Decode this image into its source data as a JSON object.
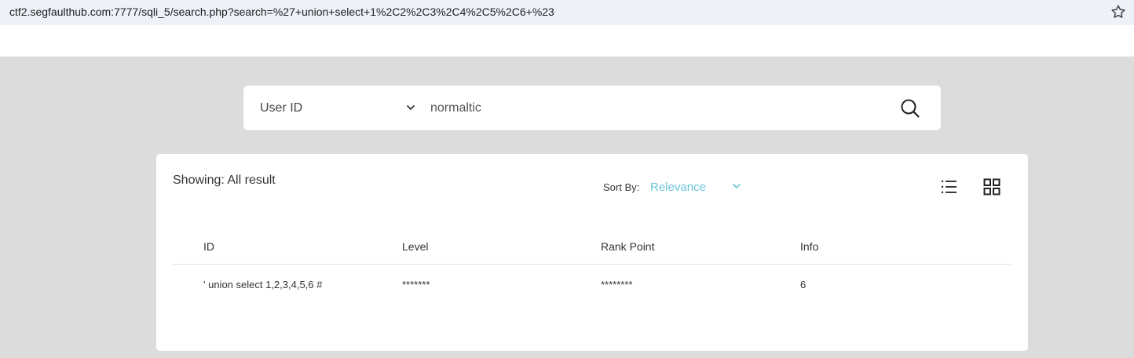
{
  "browser": {
    "url": "ctf2.segfaulthub.com:7777/sqli_5/search.php?search=%27+union+select+1%2C2%2C3%2C4%2C5%2C6+%23"
  },
  "search": {
    "field_selected": "User ID",
    "query": "normaltic"
  },
  "results": {
    "showing_text": "Showing: All result",
    "sort_label": "Sort By:",
    "sort_value": "Relevance",
    "columns": [
      "ID",
      "Level",
      "Rank Point",
      "Info"
    ],
    "rows": [
      [
        "' union select 1,2,3,4,5,6 #",
        "*******",
        "********",
        "6"
      ]
    ]
  },
  "colors": {
    "accent": "#6cc5d8",
    "page_background": "#dcdcdc"
  },
  "icons": [
    "star-icon",
    "chevron-down-icon",
    "search-icon",
    "list-view-icon",
    "grid-view-icon"
  ]
}
